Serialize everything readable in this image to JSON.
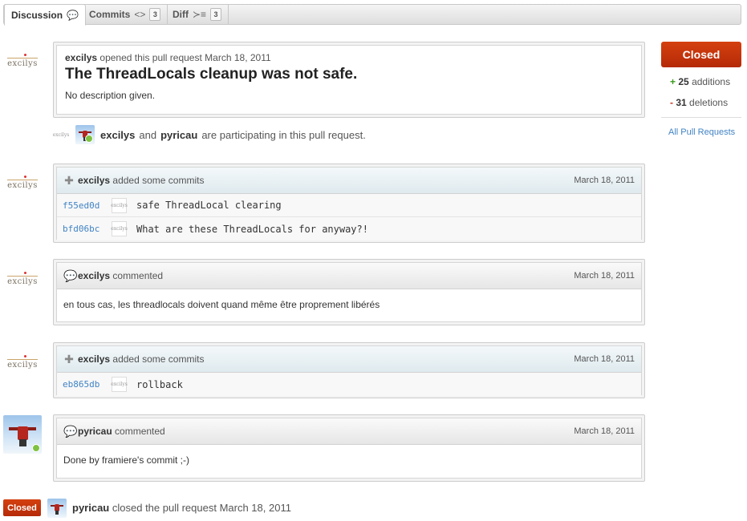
{
  "tabs": [
    {
      "label": "Discussion",
      "icon": "speech-bubbles-icon",
      "glyph": "💬"
    },
    {
      "label": "Commits",
      "icon": "code-brackets-icon",
      "glyph": "<>",
      "count": "3"
    },
    {
      "label": "Diff",
      "icon": "diff-icon",
      "glyph": "≻≡",
      "count": "3"
    }
  ],
  "opening": {
    "author": "excilys",
    "action": "opened this pull request",
    "date": "March 18, 2011",
    "title": "The ThreadLocals cleanup was not safe.",
    "description": "No description given."
  },
  "participants": {
    "user1": "excilys",
    "and": "and",
    "user2": "pyricau",
    "suffix": "are participating in this pull request."
  },
  "avatar_text": "excilys",
  "events": [
    {
      "type": "commits",
      "author": "excilys",
      "action": "added some commits",
      "date": "March 18, 2011",
      "commits": [
        {
          "sha": "f55ed0d",
          "message": "safe ThreadLocal clearing"
        },
        {
          "sha": "bfd06bc",
          "message": "What are these ThreadLocals for anyway?!"
        }
      ]
    },
    {
      "type": "comment",
      "author": "excilys",
      "action": "commented",
      "date": "March 18, 2011",
      "body": "en tous cas, les threadlocals doivent quand même être proprement libérés"
    },
    {
      "type": "commits",
      "author": "excilys",
      "action": "added some commits",
      "date": "March 18, 2011",
      "commits": [
        {
          "sha": "eb865db",
          "message": "rollback"
        }
      ]
    },
    {
      "type": "comment",
      "author": "pyricau",
      "action": "commented",
      "date": "March 18, 2011",
      "body": "Done by framiere's commit ;-)"
    }
  ],
  "closed_event": {
    "label": "Closed",
    "author": "pyricau",
    "action": "closed the pull request March 18, 2011"
  },
  "sidebar": {
    "state": "Closed",
    "additions_sign": "+",
    "additions": "25",
    "additions_label": "additions",
    "deletions_sign": "-",
    "deletions": "31",
    "deletions_label": "deletions",
    "all_link": "All Pull Requests"
  },
  "colors": {
    "closed": "#c4360c",
    "link": "#4183c4",
    "addition": "#3a9a1c",
    "deletion": "#c52d17"
  }
}
